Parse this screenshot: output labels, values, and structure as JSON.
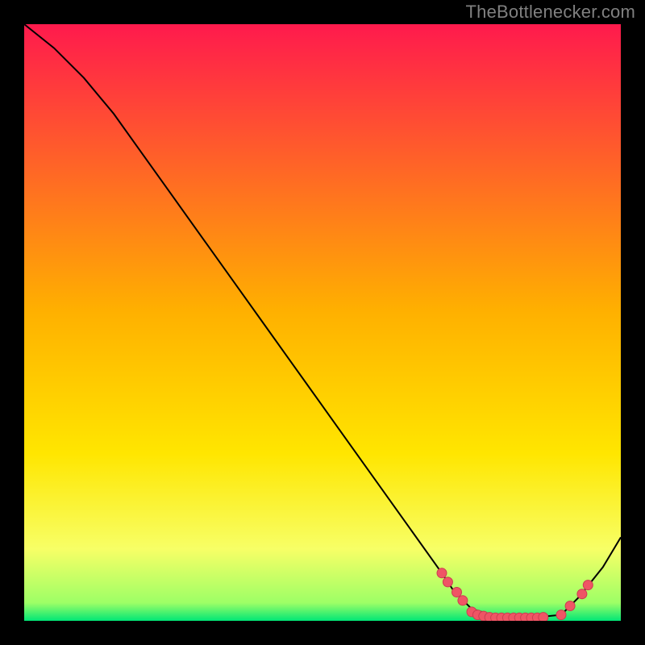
{
  "watermark": "TheBottlenecker.com",
  "chart_data": {
    "type": "line",
    "title": "",
    "xlabel": "",
    "ylabel": "",
    "xlim": [
      0,
      100
    ],
    "ylim": [
      0,
      100
    ],
    "background_gradient": [
      "#ff1a4d",
      "#ffd000",
      "#ffff4d",
      "#00e676"
    ],
    "series": [
      {
        "name": "curve",
        "color": "#000000",
        "x": [
          0,
          5,
          10,
          15,
          20,
          25,
          30,
          35,
          40,
          45,
          50,
          55,
          60,
          65,
          70,
          72,
          75,
          80,
          85,
          90,
          93,
          97,
          100
        ],
        "y": [
          100,
          96,
          91,
          85,
          78,
          71,
          64,
          57,
          50,
          43,
          36,
          29,
          22,
          15,
          8,
          5,
          2,
          0.5,
          0.5,
          1,
          4,
          9,
          14
        ]
      }
    ],
    "markers": [
      {
        "x": 70.0,
        "y": 8.0
      },
      {
        "x": 71.0,
        "y": 6.5
      },
      {
        "x": 72.5,
        "y": 4.8
      },
      {
        "x": 73.5,
        "y": 3.4
      },
      {
        "x": 75.0,
        "y": 1.5
      },
      {
        "x": 76.0,
        "y": 1.0
      },
      {
        "x": 77.0,
        "y": 0.8
      },
      {
        "x": 78.0,
        "y": 0.6
      },
      {
        "x": 79.0,
        "y": 0.5
      },
      {
        "x": 80.0,
        "y": 0.5
      },
      {
        "x": 81.0,
        "y": 0.5
      },
      {
        "x": 82.0,
        "y": 0.5
      },
      {
        "x": 83.0,
        "y": 0.5
      },
      {
        "x": 84.0,
        "y": 0.5
      },
      {
        "x": 85.0,
        "y": 0.5
      },
      {
        "x": 86.0,
        "y": 0.5
      },
      {
        "x": 87.0,
        "y": 0.6
      },
      {
        "x": 90.0,
        "y": 1.0
      },
      {
        "x": 91.5,
        "y": 2.5
      },
      {
        "x": 93.5,
        "y": 4.5
      },
      {
        "x": 94.5,
        "y": 6.0
      }
    ],
    "marker_style": {
      "fill": "#ef5565",
      "stroke": "#cc3d50",
      "radius": 6
    }
  }
}
